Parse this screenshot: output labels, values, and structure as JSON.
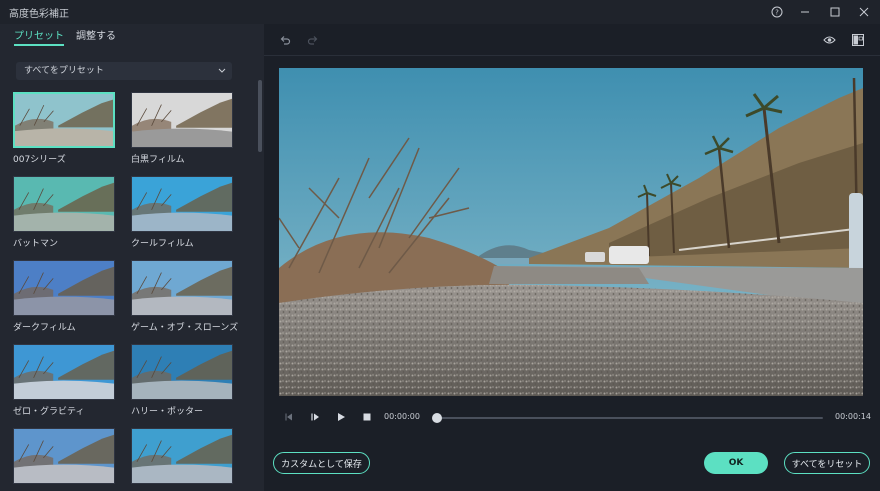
{
  "window": {
    "title": "高度色彩補正"
  },
  "tabs": [
    {
      "label": "プリセット",
      "active": true
    },
    {
      "label": "調整する",
      "active": false
    }
  ],
  "preset_filter": {
    "selected": "すべてをプリセット"
  },
  "presets": [
    {
      "label": "007シリーズ",
      "selected": true,
      "sky": "#8fc3cc",
      "ground": "#b8b4a8"
    },
    {
      "label": "白黒フィルム",
      "selected": false,
      "sky": "#d8d8d8",
      "ground": "#9a9a9a"
    },
    {
      "label": "バットマン",
      "selected": false,
      "sky": "#59b9b1",
      "ground": "#a3b3ab"
    },
    {
      "label": "クールフィルム",
      "selected": false,
      "sky": "#3aa3d8",
      "ground": "#9cb5c8"
    },
    {
      "label": "ダークフィルム",
      "selected": false,
      "sky": "#4d7fc6",
      "ground": "#8c94a8"
    },
    {
      "label": "ゲーム・オブ・スローンズ",
      "selected": false,
      "sky": "#6fa8d2",
      "ground": "#b3b8c0"
    },
    {
      "label": "ゼロ・グラビティ",
      "selected": false,
      "sky": "#3e97d4",
      "ground": "#c3cdd8"
    },
    {
      "label": "ハリー・ポッター",
      "selected": false,
      "sky": "#2e7fb5",
      "ground": "#a5b3bd"
    },
    {
      "label": "",
      "selected": false,
      "sky": "#5e95cc",
      "ground": "#b8bcc4"
    },
    {
      "label": "",
      "selected": false,
      "sky": "#3f9fcf",
      "ground": "#aab7c3"
    }
  ],
  "player": {
    "current_time": "00:00:00",
    "total_time": "00:00:14",
    "progress": 0
  },
  "buttons": {
    "save_custom": "カスタムとして保存",
    "ok": "OK",
    "reset_all": "すべてをリセット"
  },
  "colors": {
    "accent": "#5ce0c2",
    "panel": "#232730",
    "background": "#1b1f27"
  },
  "icons": [
    "help-icon",
    "minimize-icon",
    "maximize-icon",
    "close-icon",
    "undo-icon",
    "redo-icon",
    "eye-icon",
    "compare-icon",
    "prev-frame-icon",
    "play-pause-icon",
    "play-icon",
    "stop-icon",
    "chevron-down-icon"
  ]
}
